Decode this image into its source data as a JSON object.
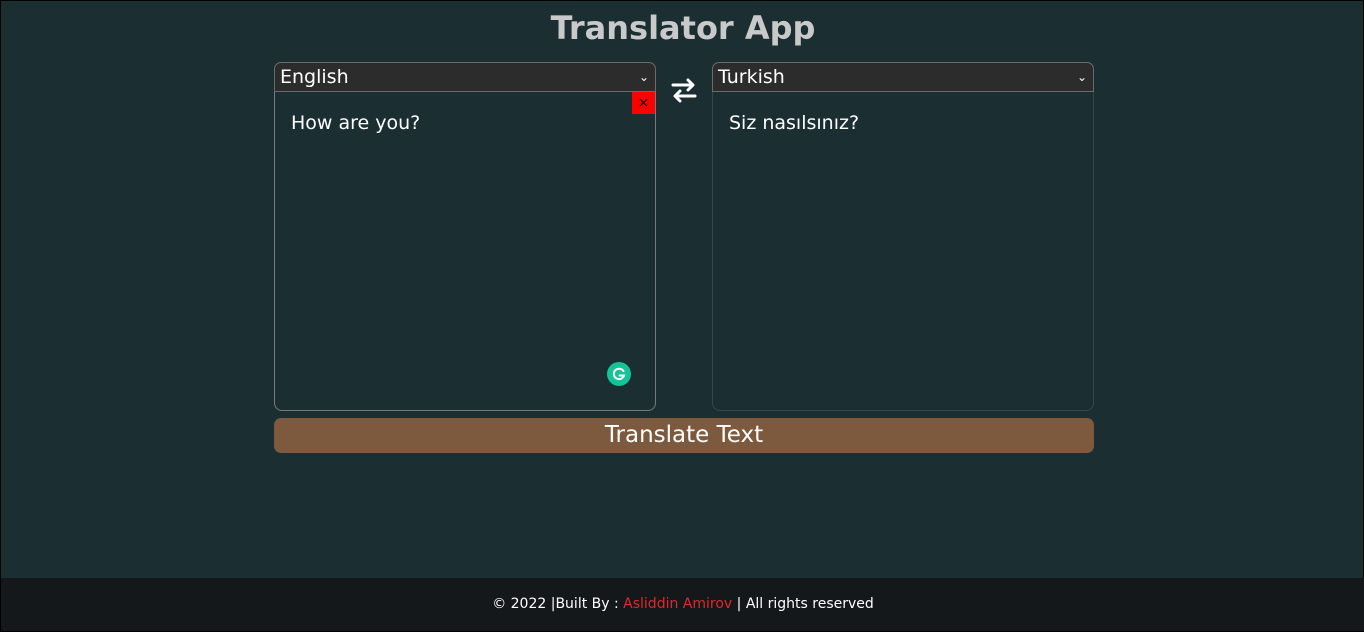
{
  "header": {
    "title": "Translator App"
  },
  "source": {
    "language": "English",
    "text": "How are you?",
    "clear_label": "×"
  },
  "target": {
    "language": "Turkish",
    "text": "Siz nasılsınız?"
  },
  "actions": {
    "translate_label": "Translate Text",
    "swap_icon": "swap-arrows-icon"
  },
  "footer": {
    "prefix": "© 2022 |Built By : ",
    "author": "Asliddin Amirov",
    "suffix": " | All rights reserved"
  },
  "colors": {
    "background": "#1b2e32",
    "select_bg": "#2c2c2c",
    "button_bg": "#7d5a3d",
    "clear_bg": "#ff0000",
    "footer_bg": "#14181a",
    "author": "#e0282d",
    "grammarly": "#15c39a"
  }
}
